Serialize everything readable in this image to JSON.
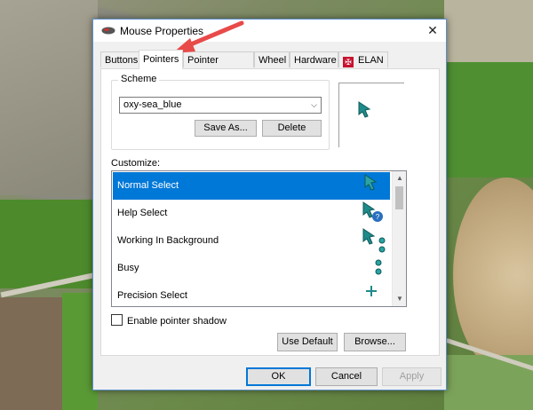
{
  "window": {
    "title": "Mouse Properties",
    "close_glyph": "✕"
  },
  "tabs": [
    {
      "label": "Buttons"
    },
    {
      "label": "Pointers"
    },
    {
      "label": "Pointer Options"
    },
    {
      "label": "Wheel"
    },
    {
      "label": "Hardware"
    },
    {
      "label": "ELAN"
    }
  ],
  "scheme": {
    "label": "Scheme",
    "selected": "oxy-sea_blue",
    "save_as_label": "Save As...",
    "delete_label": "Delete"
  },
  "customize": {
    "label": "Customize:",
    "items": [
      {
        "label": "Normal Select",
        "icon": "arrow-pointer-icon"
      },
      {
        "label": "Help Select",
        "icon": "help-pointer-icon"
      },
      {
        "label": "Working In Background",
        "icon": "working-pointer-icon"
      },
      {
        "label": "Busy",
        "icon": "busy-pointer-icon"
      },
      {
        "label": "Precision Select",
        "icon": "crosshair-pointer-icon"
      }
    ]
  },
  "shadow": {
    "label": "Enable pointer shadow",
    "checked": false
  },
  "actions": {
    "use_default": "Use Default",
    "browse": "Browse...",
    "ok": "OK",
    "cancel": "Cancel",
    "apply": "Apply"
  },
  "colors": {
    "accent": "#0078d7",
    "cursor_teal": "#1f8a8a",
    "arrow_red": "#e84a4a"
  }
}
